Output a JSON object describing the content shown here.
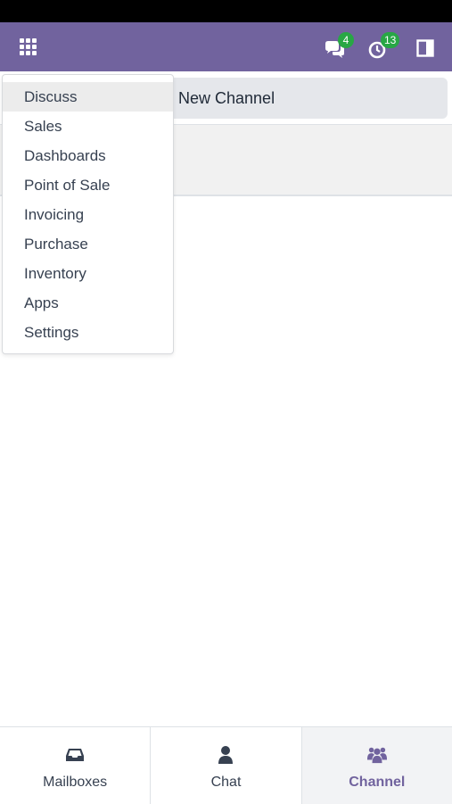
{
  "navbar": {
    "brand_color": "#71639e",
    "apps_icon": "grid-icon",
    "messages_badge": "4",
    "activities_badge": "13",
    "badge_color": "#28a745"
  },
  "control": {
    "new_channel_label": "New Channel"
  },
  "app_menu": {
    "items": [
      {
        "label": "Discuss",
        "active": true
      },
      {
        "label": "Sales"
      },
      {
        "label": "Dashboards"
      },
      {
        "label": "Point of Sale"
      },
      {
        "label": "Invoicing"
      },
      {
        "label": "Purchase"
      },
      {
        "label": "Inventory"
      },
      {
        "label": "Apps"
      },
      {
        "label": "Settings"
      }
    ]
  },
  "bottom_nav": {
    "tabs": [
      {
        "label": "Mailboxes",
        "icon": "inbox-icon"
      },
      {
        "label": "Chat",
        "icon": "user-icon"
      },
      {
        "label": "Channel",
        "icon": "users-icon",
        "active": true
      }
    ]
  }
}
